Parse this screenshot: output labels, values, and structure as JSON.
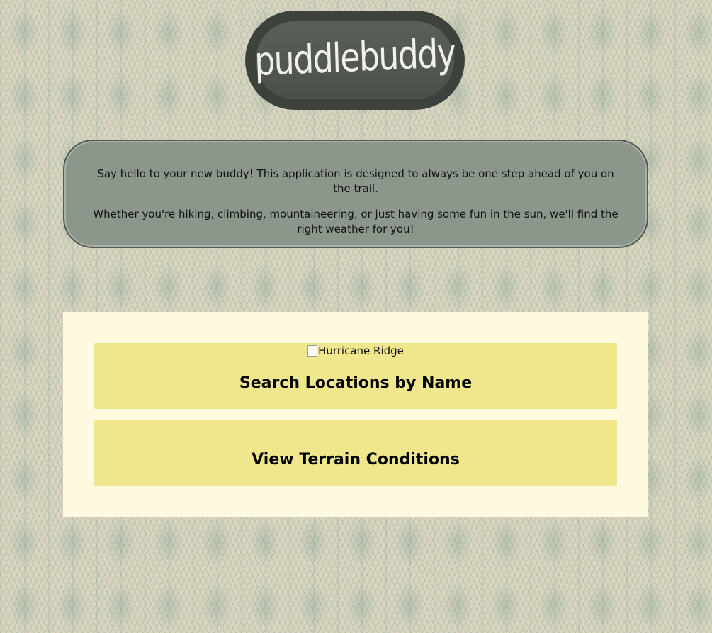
{
  "brand": {
    "logo_text": "puddlebuddy"
  },
  "intro": {
    "line1": "Say hello to your new buddy! This application is designed to always be one step ahead of you on the trail.",
    "line2": "Whether you're hiking, climbing, mountaineering, or just having some fun in the sun, we'll find the right weather for you!"
  },
  "menu": {
    "search": {
      "image_alt": "Hurricane Ridge",
      "label": "Search Locations by Name"
    },
    "terrain": {
      "label": "View Terrain Conditions"
    }
  },
  "colors": {
    "tile": "#f0e68c",
    "panel": "#fff9df",
    "logo_bg": "#3d423d",
    "intro_bg": "#879288"
  }
}
